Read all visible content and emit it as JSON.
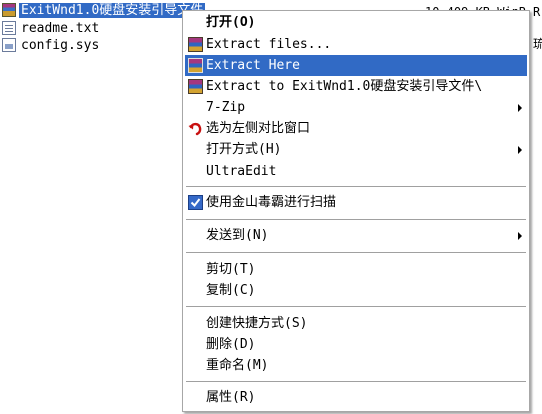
{
  "files": [
    {
      "name": "ExitWnd1.0硬盘安装引导文件",
      "icon": "winrar-archive-icon",
      "selected": true
    },
    {
      "name": "readme.txt",
      "icon": "text-file-icon",
      "selected": false
    },
    {
      "name": "config.sys",
      "icon": "system-file-icon",
      "selected": false
    }
  ],
  "file_details": [
    "10,409 KB  WinR",
    "",
    ""
  ],
  "right_edge": [
    "R",
    "",
    "琉"
  ],
  "menu": {
    "open": "打开(O)",
    "extract_files": "Extract files...",
    "extract_here": "Extract Here",
    "extract_to": "Extract to ExitWnd1.0硬盘安装引导文件\\",
    "seven_zip": "7-Zip",
    "select_left_compare": "选为左侧对比窗口",
    "open_with": "打开方式(H)",
    "ultraedit": "UltraEdit",
    "scan_with_kingsoft": "使用金山毒霸进行扫描",
    "send_to": "发送到(N)",
    "cut": "剪切(T)",
    "copy": "复制(C)",
    "create_shortcut": "创建快捷方式(S)",
    "delete": "删除(D)",
    "rename": "重命名(M)",
    "properties": "属性(R)"
  },
  "colors": {
    "highlight": "#316ac5",
    "menu_bg": "#ffffff",
    "separator": "#a0a0a0"
  }
}
